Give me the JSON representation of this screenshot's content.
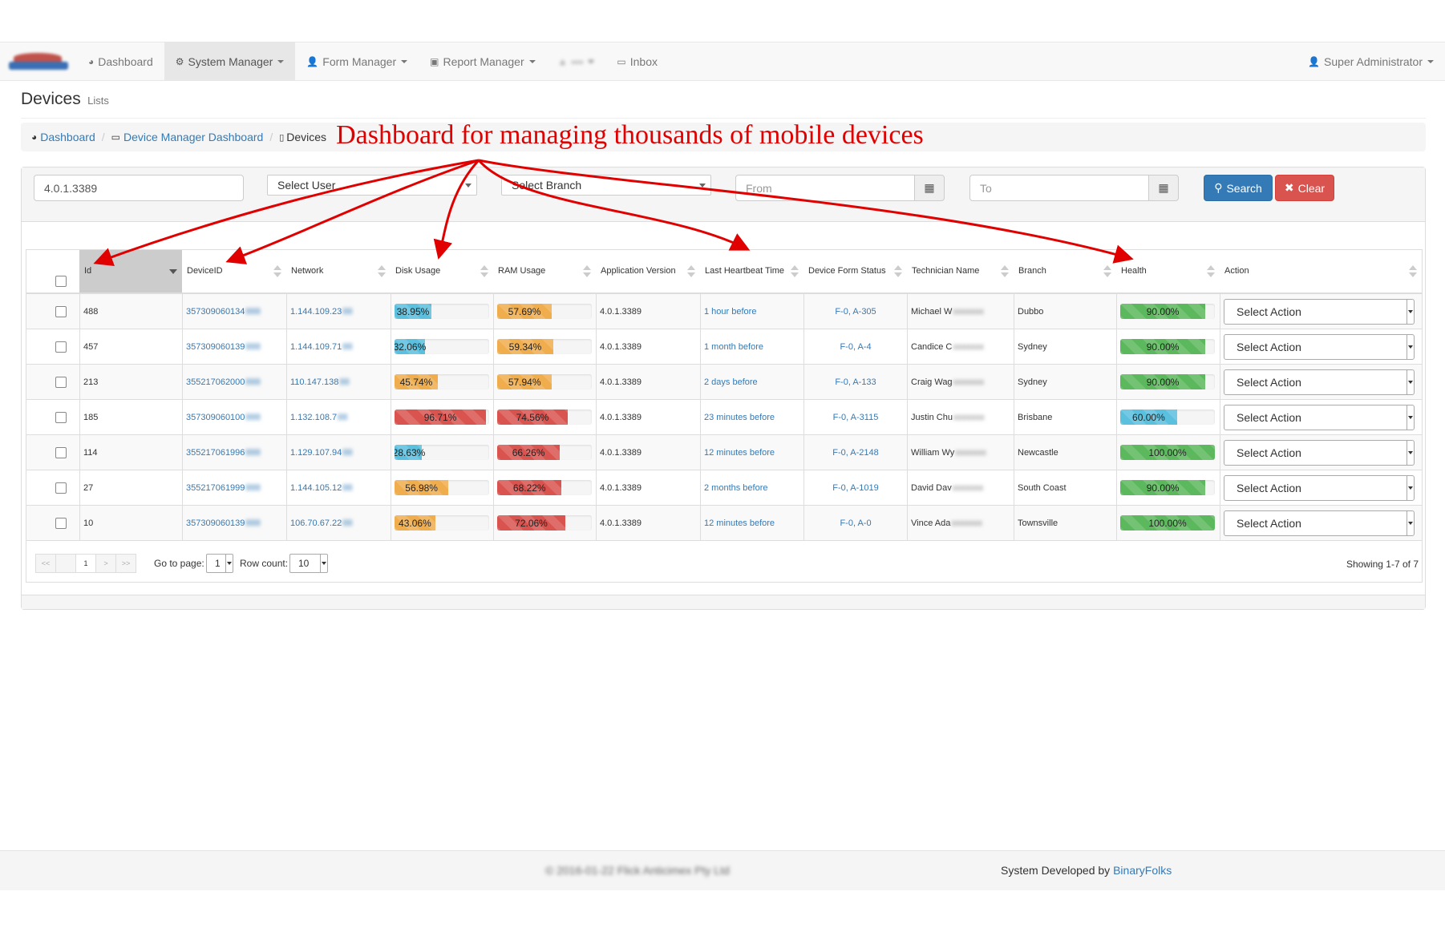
{
  "navbar": {
    "items": [
      {
        "icon": "dashboard-icon",
        "glyph": "◕",
        "label": "Dashboard"
      },
      {
        "icon": "gear-icon",
        "glyph": "⚙",
        "label": "System Manager"
      },
      {
        "icon": "user-icon",
        "glyph": "👤",
        "label": "Form Manager"
      },
      {
        "icon": "briefcase-icon",
        "glyph": "▣",
        "label": "Report Manager"
      },
      {
        "icon": "inbox-icon",
        "glyph": "▭",
        "label": "Inbox"
      }
    ],
    "user_label": "Super Administrator"
  },
  "page": {
    "title": "Devices",
    "subtitle": "Lists"
  },
  "breadcrumb": {
    "items": [
      "Dashboard",
      "Device Manager Dashboard",
      "Devices"
    ]
  },
  "annotation": "Dashboard for managing thousands of mobile devices",
  "filters": {
    "search_value": "4.0.1.3389",
    "user_select": "Select User",
    "branch_select": "Select Branch",
    "from_placeholder": "From",
    "to_placeholder": "To",
    "search_label": "Search",
    "clear_label": "Clear"
  },
  "table": {
    "columns": [
      "Id",
      "DeviceID",
      "Network",
      "Disk Usage",
      "RAM Usage",
      "Application Version",
      "Last Heartbeat Time",
      "Device Form Status",
      "Technician Name",
      "Branch",
      "Health",
      "Action"
    ],
    "action_placeholder": "Select Action",
    "rows": [
      {
        "id": "488",
        "device": "3573090601348",
        "network": "1.144.109.23",
        "disk": 38.95,
        "disk_label": "38.95%",
        "ram": 57.69,
        "ram_label": "57.69%",
        "version": "4.0.1.3389",
        "heartbeat": "1 hour before",
        "form_status": "F-0, A-305",
        "tech": "Michael W",
        "branch": "Dubbo",
        "health": 90,
        "health_label": "90.00%"
      },
      {
        "id": "457",
        "device": "3573090601398",
        "network": "1.144.109.71",
        "disk": 32.06,
        "disk_label": "32.06%",
        "ram": 59.34,
        "ram_label": "59.34%",
        "version": "4.0.1.3389",
        "heartbeat": "1 month before",
        "form_status": "F-0, A-4",
        "tech": "Candice C",
        "branch": "Sydney",
        "health": 90,
        "health_label": "90.00%"
      },
      {
        "id": "213",
        "device": "3552170620008",
        "network": "110.147.138",
        "disk": 45.74,
        "disk_label": "45.74%",
        "ram": 57.94,
        "ram_label": "57.94%",
        "version": "4.0.1.3389",
        "heartbeat": "2 days before",
        "form_status": "F-0, A-133",
        "tech": "Craig Wag",
        "branch": "Sydney",
        "health": 90,
        "health_label": "90.00%"
      },
      {
        "id": "185",
        "device": "3573090601008",
        "network": "1.132.108.7",
        "disk": 96.71,
        "disk_label": "96.71%",
        "ram": 74.56,
        "ram_label": "74.56%",
        "version": "4.0.1.3389",
        "heartbeat": "23 minutes before",
        "form_status": "F-0, A-3115",
        "tech": "Justin Chu",
        "branch": "Brisbane",
        "health": 60,
        "health_label": "60.00%"
      },
      {
        "id": "114",
        "device": "3552170619968",
        "network": "1.129.107.94",
        "disk": 28.63,
        "disk_label": "28.63%",
        "ram": 66.26,
        "ram_label": "66.26%",
        "version": "4.0.1.3389",
        "heartbeat": "12 minutes before",
        "form_status": "F-0, A-2148",
        "tech": "William Wy",
        "branch": "Newcastle",
        "health": 100,
        "health_label": "100.00%"
      },
      {
        "id": "27",
        "device": "3552170619998",
        "network": "1.144.105.12",
        "disk": 56.98,
        "disk_label": "56.98%",
        "ram": 68.22,
        "ram_label": "68.22%",
        "version": "4.0.1.3389",
        "heartbeat": "2 months before",
        "form_status": "F-0, A-1019",
        "tech": "David Dav",
        "branch": "South Coast",
        "health": 90,
        "health_label": "90.00%"
      },
      {
        "id": "10",
        "device": "3573090601398",
        "network": "106.70.67.22",
        "disk": 43.06,
        "disk_label": "43.06%",
        "ram": 72.06,
        "ram_label": "72.06%",
        "version": "4.0.1.3389",
        "heartbeat": "12 minutes before",
        "form_status": "F-0, A-0",
        "tech": "Vince Ada",
        "branch": "Townsville",
        "health": 100,
        "health_label": "100.00%"
      }
    ]
  },
  "pager": {
    "first": "<<",
    "prev": "<",
    "page": "1",
    "next": ">",
    "last": ">>",
    "goto_label": "Go to page:",
    "goto_value": "1",
    "rowcount_label": "Row count:",
    "rowcount_value": "10",
    "showing": "Showing 1-7 of 7"
  },
  "footer": {
    "copyright": "© 2016-01-22 Flick Anticimex Pty Ltd",
    "developed_prefix": "System Developed by",
    "developed_link": "BinaryFolks"
  },
  "colors": {
    "info": "#5bc0de",
    "warning": "#f0ad4e",
    "danger": "#d9534f",
    "success": "#5cb85c",
    "annotation": "#e00000"
  }
}
